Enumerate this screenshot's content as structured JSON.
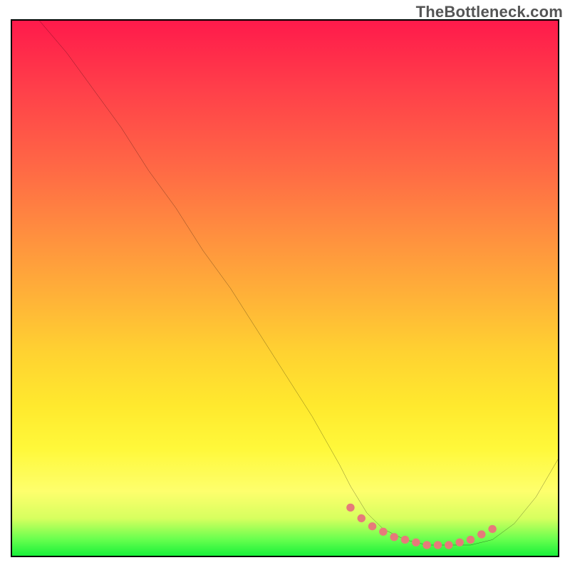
{
  "watermark": "TheBottleneck.com",
  "chart_data": {
    "type": "line",
    "title": "",
    "xlabel": "",
    "ylabel": "",
    "xlim": [
      0,
      100
    ],
    "ylim": [
      0,
      100
    ],
    "grid": false,
    "legend": false,
    "annotations": [],
    "series": [
      {
        "name": "bottleneck-curve",
        "color": "#000000",
        "x": [
          5,
          10,
          15,
          20,
          25,
          30,
          35,
          40,
          45,
          50,
          55,
          60,
          62,
          65,
          68,
          72,
          76,
          80,
          84,
          88,
          92,
          96,
          100
        ],
        "y": [
          100,
          94,
          87,
          80,
          72,
          65,
          57,
          50,
          42,
          34,
          26,
          17,
          13,
          8,
          5,
          3,
          2,
          2,
          2,
          3,
          6,
          11,
          18
        ]
      }
    ],
    "sweet_spot_markers": {
      "name": "optimal-range-dots",
      "color": "#e67a7a",
      "x": [
        62,
        64,
        66,
        68,
        70,
        72,
        74,
        76,
        78,
        80,
        82,
        84,
        86,
        88
      ],
      "y": [
        9,
        7,
        5.5,
        4.5,
        3.5,
        3,
        2.5,
        2,
        2,
        2,
        2.5,
        3,
        4,
        5
      ]
    },
    "gradient_stops": [
      {
        "pos": 0.0,
        "color": "#ff1a4b"
      },
      {
        "pos": 0.28,
        "color": "#ff6a45"
      },
      {
        "pos": 0.52,
        "color": "#ffb338"
      },
      {
        "pos": 0.72,
        "color": "#ffe92e"
      },
      {
        "pos": 0.88,
        "color": "#feff6d"
      },
      {
        "pos": 0.97,
        "color": "#66ff4e"
      },
      {
        "pos": 1.0,
        "color": "#19f03a"
      }
    ]
  }
}
